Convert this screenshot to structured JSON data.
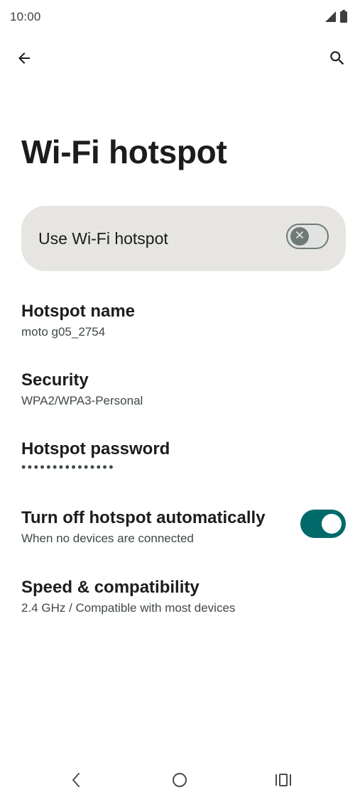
{
  "status_bar": {
    "time": "10:00"
  },
  "app_bar": {
    "back_icon": "arrow-back-icon",
    "search_icon": "search-icon"
  },
  "page": {
    "title": "Wi-Fi hotspot"
  },
  "main_switch": {
    "label": "Use Wi-Fi hotspot",
    "checked": false
  },
  "preferences": [
    {
      "title": "Hotspot name",
      "summary": "moto g05_2754"
    },
    {
      "title": "Security",
      "summary": "WPA2/WPA3-Personal"
    },
    {
      "title": "Hotspot password",
      "summary": "•••••••••••••••"
    },
    {
      "title": "Turn off hotspot automatically",
      "summary": "When no devices are connected",
      "checked": true
    },
    {
      "title": "Speed & compatibility",
      "summary": "2.4 GHz / Compatible with most devices"
    }
  ],
  "colors": {
    "accent": "#006a6a",
    "card_background": "#e7e5e1",
    "text_primary": "#1b1c1c",
    "text_secondary": "#3f4948"
  },
  "nav_bar": {
    "back_icon": "nav-back-icon",
    "home_icon": "nav-home-icon",
    "recents_icon": "nav-recents-icon"
  }
}
